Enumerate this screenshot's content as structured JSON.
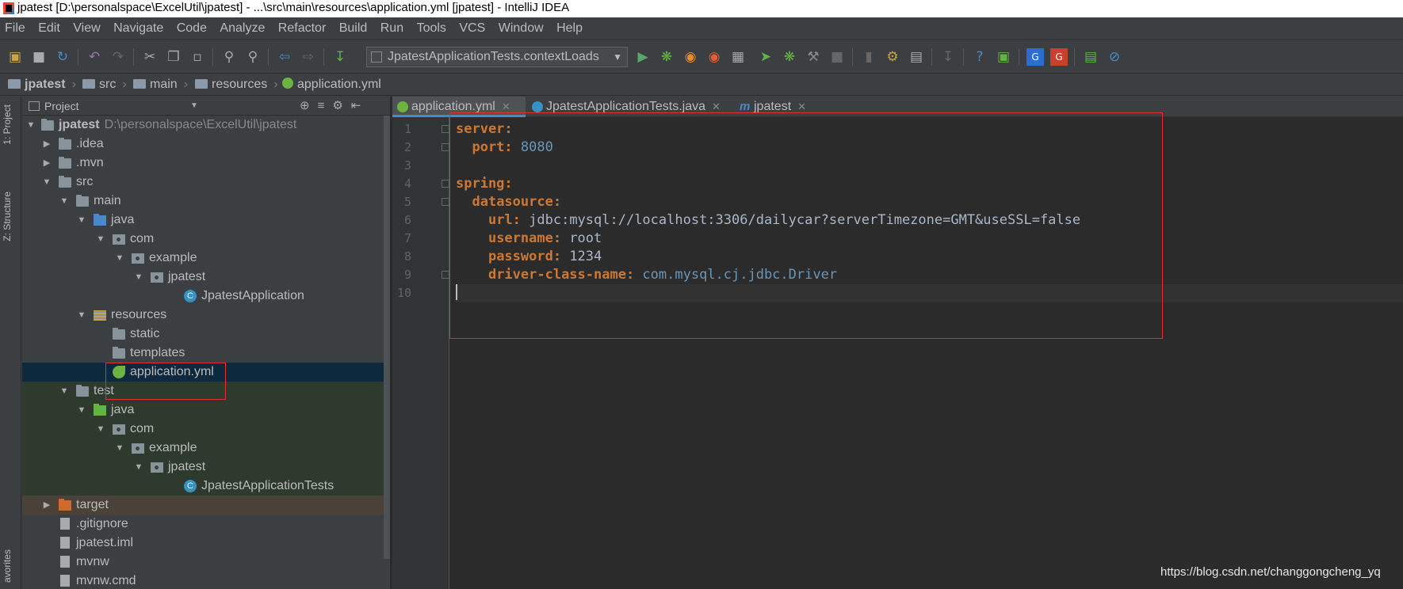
{
  "window": {
    "title": "jpatest [D:\\personalspace\\ExcelUtil\\jpatest] - ...\\src\\main\\resources\\application.yml [jpatest] - IntelliJ IDEA"
  },
  "menu": [
    "File",
    "Edit",
    "View",
    "Navigate",
    "Code",
    "Analyze",
    "Refactor",
    "Build",
    "Run",
    "Tools",
    "VCS",
    "Window",
    "Help"
  ],
  "toolbar": {
    "run_config": "JpatestApplicationTests.contextLoads"
  },
  "breadcrumb": [
    "jpatest",
    "src",
    "main",
    "resources",
    "application.yml"
  ],
  "side_tabs": {
    "project": "1: Project",
    "structure": "Z: Structure",
    "favorites": "avorites"
  },
  "project_panel": {
    "header": "Project",
    "tree": [
      {
        "label": "jpatest",
        "extra": "D:\\personalspace\\ExcelUtil\\jpatest"
      },
      {
        "label": ".idea"
      },
      {
        "label": ".mvn"
      },
      {
        "label": "src"
      },
      {
        "label": "main"
      },
      {
        "label": "java"
      },
      {
        "label": "com"
      },
      {
        "label": "example"
      },
      {
        "label": "jpatest"
      },
      {
        "label": "JpatestApplication"
      },
      {
        "label": "resources"
      },
      {
        "label": "static"
      },
      {
        "label": "templates"
      },
      {
        "label": "application.yml"
      },
      {
        "label": "test"
      },
      {
        "label": "java"
      },
      {
        "label": "com"
      },
      {
        "label": "example"
      },
      {
        "label": "jpatest"
      },
      {
        "label": "JpatestApplicationTests"
      },
      {
        "label": "target"
      },
      {
        "label": ".gitignore"
      },
      {
        "label": "jpatest.iml"
      },
      {
        "label": "mvnw"
      },
      {
        "label": "mvnw.cmd"
      }
    ]
  },
  "editor": {
    "tabs": [
      {
        "label": "application.yml"
      },
      {
        "label": "JpatestApplicationTests.java"
      },
      {
        "label": "jpatest"
      }
    ],
    "line_numbers": [
      "1",
      "2",
      "3",
      "4",
      "5",
      "6",
      "7",
      "8",
      "9",
      "10"
    ],
    "lines": [
      {
        "key": "server:",
        "value": ""
      },
      {
        "key": "port:",
        "value": " 8080"
      },
      {
        "key": "",
        "value": ""
      },
      {
        "key": "spring:",
        "value": ""
      },
      {
        "key": "datasource:",
        "value": ""
      },
      {
        "key": "url:",
        "value": " jdbc:mysql://localhost:3306/dailycar?serverTimezone=GMT&useSSL=false"
      },
      {
        "key": "username:",
        "value": " root"
      },
      {
        "key": "password:",
        "value": " 1234"
      },
      {
        "key": "driver-class-name:",
        "value": " com.mysql.cj.jdbc.Driver"
      },
      {
        "key": "",
        "value": ""
      }
    ]
  },
  "watermark": "https://blog.csdn.net/changgongcheng_yq",
  "colors": {
    "background": "#2b2b2b",
    "panel": "#3c3f41",
    "keyword": "#cc7832",
    "number": "#6897bb",
    "highlight_box": "#e03030",
    "selection": "#0d293e"
  }
}
